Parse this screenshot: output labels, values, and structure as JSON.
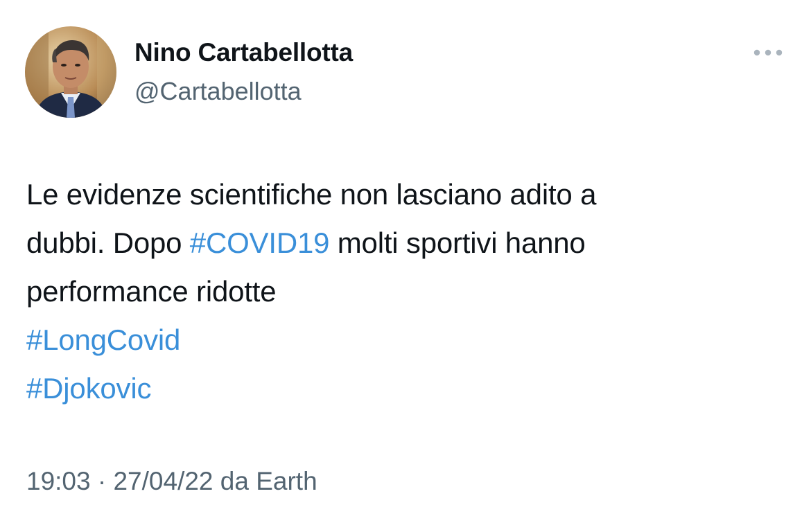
{
  "tweet": {
    "author_name": "Nino Cartabellotta",
    "author_handle": "@Cartabellotta",
    "more_icon": "more-horizontal-icon",
    "text": {
      "line1": "Le evidenze scientifiche non lasciano adito a",
      "line2_before": "dubbi. Dopo ",
      "line2_hashtag": "#COVID19",
      "line2_after": " molti sportivi hanno",
      "line3": "performance ridotte",
      "hashtag_longcovid": "#LongCovid",
      "hashtag_djokovic": "#Djokovic"
    },
    "time": "19:03",
    "separator": "·",
    "date": "27/04/22",
    "source": "da Earth"
  },
  "colors": {
    "hashtag": "#3a8fd9",
    "secondary_text": "#536471",
    "primary_text": "#0f1419",
    "background": "#ffffff"
  }
}
